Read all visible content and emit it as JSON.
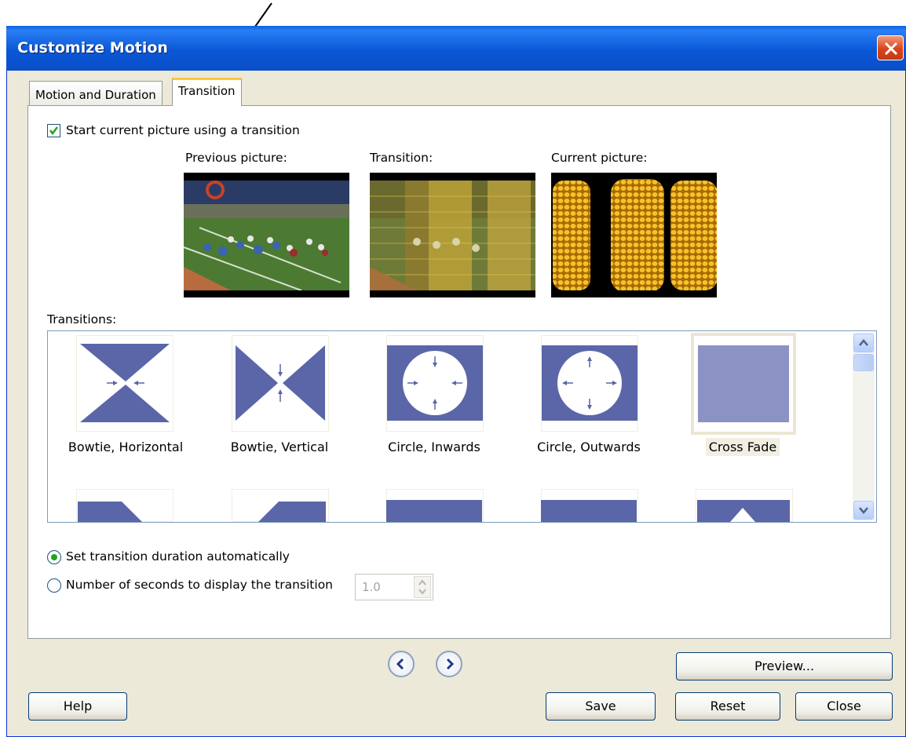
{
  "window": {
    "title": "Customize Motion"
  },
  "tabs": [
    {
      "label": "Motion and Duration",
      "active": false
    },
    {
      "label": "Transition",
      "active": true
    }
  ],
  "start_transition": {
    "label": "Start current picture using a transition",
    "checked": true
  },
  "previews": {
    "previous_label": "Previous picture:",
    "transition_label": "Transition:",
    "current_label": "Current picture:"
  },
  "transitions": {
    "label": "Transitions:",
    "items": [
      {
        "name": "Bowtie, Horizontal",
        "icon": "bowtie-horizontal-icon"
      },
      {
        "name": "Bowtie, Vertical",
        "icon": "bowtie-vertical-icon"
      },
      {
        "name": "Circle, Inwards",
        "icon": "circle-inwards-icon"
      },
      {
        "name": "Circle, Outwards",
        "icon": "circle-outwards-icon"
      },
      {
        "name": "Cross Fade",
        "icon": "cross-fade-icon",
        "selected": true
      }
    ]
  },
  "duration": {
    "auto_label": "Set transition duration automatically",
    "auto_selected": true,
    "manual_label": "Number of seconds to display the transition",
    "seconds_value": "1.0"
  },
  "buttons": {
    "preview": "Preview...",
    "help": "Help",
    "save": "Save",
    "reset": "Reset",
    "close": "Close"
  },
  "colors": {
    "accent": "#5a66a8",
    "titlebar": "#0a57d6",
    "checkmark": "#21a121"
  }
}
